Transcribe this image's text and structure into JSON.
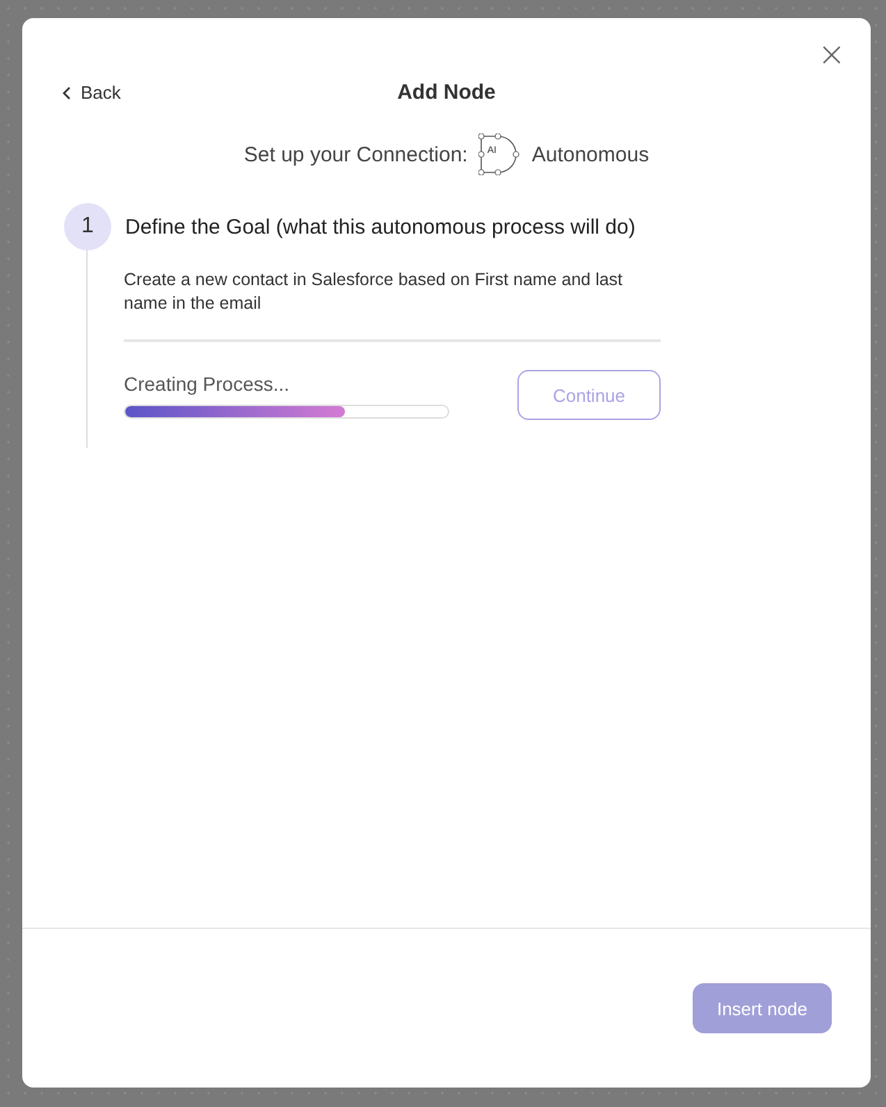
{
  "header": {
    "back": "Back",
    "title": "Add Node",
    "close": "×"
  },
  "connection": {
    "label": "Set up your Connection:",
    "icon_label": "AI",
    "name": "Autonomous"
  },
  "step": {
    "number": "1",
    "title": "Define the Goal (what this autonomous process will do)",
    "goal": "Create a new contact in Salesforce based on First name and last name in the email",
    "status": "Creating Process...",
    "level": 0.68,
    "continue": {
      "label": "Continue",
      "disabled": true
    }
  },
  "footer": {
    "insert": {
      "label": "Insert node",
      "disabled": true
    }
  }
}
